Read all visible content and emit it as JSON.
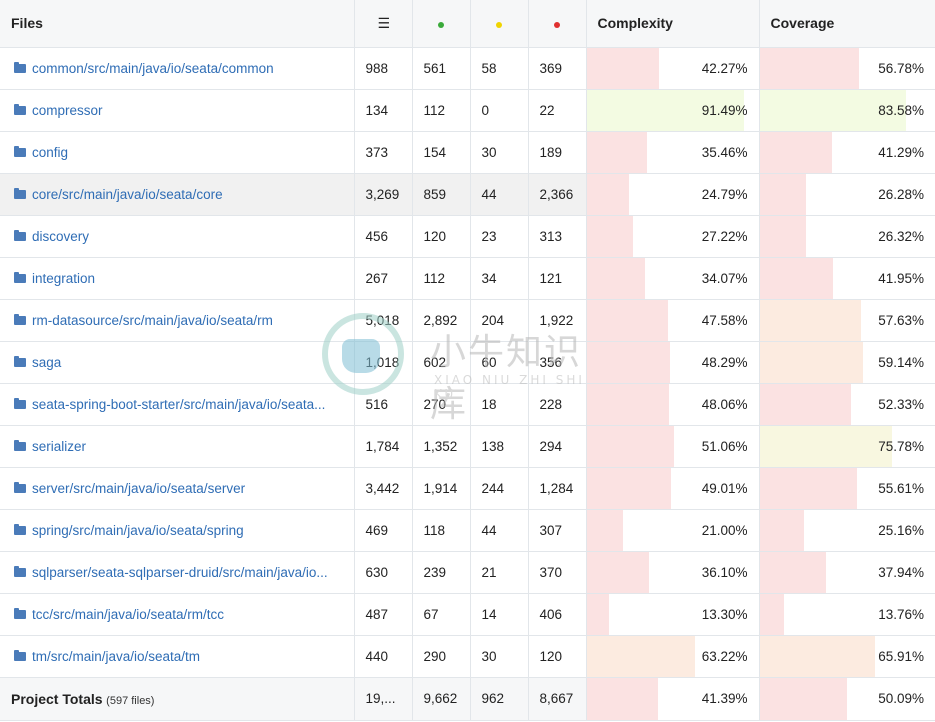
{
  "header": {
    "files": "Files",
    "lines_icon": "lines-icon",
    "complexity": "Complexity",
    "coverage": "Coverage",
    "colors": {
      "covered": "#3aaa3a",
      "partial": "#f0d400",
      "missed": "#e03030"
    }
  },
  "rows": [
    {
      "name": "common/src/main/java/io/seata/common",
      "lines": "988",
      "covered": "561",
      "partial": "58",
      "missed": "369",
      "complexity": "42.27%",
      "coverage": "56.78%",
      "complexity_fraction": 0.4227,
      "coverage_fraction": 0.5678,
      "complexity_color": "#fbe2e2",
      "coverage_color": "#fbe2e2"
    },
    {
      "name": "compressor",
      "lines": "134",
      "covered": "112",
      "partial": "0",
      "missed": "22",
      "complexity": "91.49%",
      "coverage": "83.58%",
      "complexity_fraction": 0.9149,
      "coverage_fraction": 0.8358,
      "complexity_color": "#f3fbe2",
      "coverage_color": "#f3fbe2"
    },
    {
      "name": "config",
      "lines": "373",
      "covered": "154",
      "partial": "30",
      "missed": "189",
      "complexity": "35.46%",
      "coverage": "41.29%",
      "complexity_fraction": 0.3546,
      "coverage_fraction": 0.4129,
      "complexity_color": "#fbe2e2",
      "coverage_color": "#fbe2e2"
    },
    {
      "name": "core/src/main/java/io/seata/core",
      "lines": "3,269",
      "covered": "859",
      "partial": "44",
      "missed": "2,366",
      "complexity": "24.79%",
      "coverage": "26.28%",
      "complexity_fraction": 0.2479,
      "coverage_fraction": 0.2628,
      "complexity_color": "#fbe2e2",
      "coverage_color": "#fbe2e2",
      "highlight": true
    },
    {
      "name": "discovery",
      "lines": "456",
      "covered": "120",
      "partial": "23",
      "missed": "313",
      "complexity": "27.22%",
      "coverage": "26.32%",
      "complexity_fraction": 0.2722,
      "coverage_fraction": 0.2632,
      "complexity_color": "#fbe2e2",
      "coverage_color": "#fbe2e2"
    },
    {
      "name": "integration",
      "lines": "267",
      "covered": "112",
      "partial": "34",
      "missed": "121",
      "complexity": "34.07%",
      "coverage": "41.95%",
      "complexity_fraction": 0.3407,
      "coverage_fraction": 0.4195,
      "complexity_color": "#fbe2e2",
      "coverage_color": "#fbe2e2"
    },
    {
      "name": "rm-datasource/src/main/java/io/seata/rm",
      "lines": "5,018",
      "covered": "2,892",
      "partial": "204",
      "missed": "1,922",
      "complexity": "47.58%",
      "coverage": "57.63%",
      "complexity_fraction": 0.4758,
      "coverage_fraction": 0.5763,
      "complexity_color": "#fbe2e2",
      "coverage_color": "#fcebe0"
    },
    {
      "name": "saga",
      "lines": "1,018",
      "covered": "602",
      "partial": "60",
      "missed": "356",
      "complexity": "48.29%",
      "coverage": "59.14%",
      "complexity_fraction": 0.4829,
      "coverage_fraction": 0.5914,
      "complexity_color": "#fbe2e2",
      "coverage_color": "#fcebe0"
    },
    {
      "name": "seata-spring-boot-starter/src/main/java/io/seata...",
      "lines": "516",
      "covered": "270",
      "partial": "18",
      "missed": "228",
      "complexity": "48.06%",
      "coverage": "52.33%",
      "complexity_fraction": 0.4806,
      "coverage_fraction": 0.5233,
      "complexity_color": "#fbe2e2",
      "coverage_color": "#fbe2e2"
    },
    {
      "name": "serializer",
      "lines": "1,784",
      "covered": "1,352",
      "partial": "138",
      "missed": "294",
      "complexity": "51.06%",
      "coverage": "75.78%",
      "complexity_fraction": 0.5106,
      "coverage_fraction": 0.7578,
      "complexity_color": "#fbe2e2",
      "coverage_color": "#f8f7e0"
    },
    {
      "name": "server/src/main/java/io/seata/server",
      "lines": "3,442",
      "covered": "1,914",
      "partial": "244",
      "missed": "1,284",
      "complexity": "49.01%",
      "coverage": "55.61%",
      "complexity_fraction": 0.4901,
      "coverage_fraction": 0.5561,
      "complexity_color": "#fbe2e2",
      "coverage_color": "#fbe2e2"
    },
    {
      "name": "spring/src/main/java/io/seata/spring",
      "lines": "469",
      "covered": "118",
      "partial": "44",
      "missed": "307",
      "complexity": "21.00%",
      "coverage": "25.16%",
      "complexity_fraction": 0.21,
      "coverage_fraction": 0.2516,
      "complexity_color": "#fbe2e2",
      "coverage_color": "#fbe2e2"
    },
    {
      "name": "sqlparser/seata-sqlparser-druid/src/main/java/io...",
      "lines": "630",
      "covered": "239",
      "partial": "21",
      "missed": "370",
      "complexity": "36.10%",
      "coverage": "37.94%",
      "complexity_fraction": 0.361,
      "coverage_fraction": 0.3794,
      "complexity_color": "#fbe2e2",
      "coverage_color": "#fbe2e2"
    },
    {
      "name": "tcc/src/main/java/io/seata/rm/tcc",
      "lines": "487",
      "covered": "67",
      "partial": "14",
      "missed": "406",
      "complexity": "13.30%",
      "coverage": "13.76%",
      "complexity_fraction": 0.133,
      "coverage_fraction": 0.1376,
      "complexity_color": "#fbe2e2",
      "coverage_color": "#fbe2e2"
    },
    {
      "name": "tm/src/main/java/io/seata/tm",
      "lines": "440",
      "covered": "290",
      "partial": "30",
      "missed": "120",
      "complexity": "63.22%",
      "coverage": "65.91%",
      "complexity_fraction": 0.6322,
      "coverage_fraction": 0.6591,
      "complexity_color": "#fcebe0",
      "coverage_color": "#fcebe0"
    }
  ],
  "totals": {
    "label": "Project Totals",
    "count": "(597 files)",
    "lines": "19,...",
    "covered": "9,662",
    "partial": "962",
    "missed": "8,667",
    "complexity": "41.39%",
    "coverage": "50.09%",
    "complexity_fraction": 0.4139,
    "coverage_fraction": 0.5009,
    "complexity_color": "#fbe2e2",
    "coverage_color": "#fbe2e2"
  },
  "watermark": {
    "title": "小牛知识库",
    "subtitle": "XIAO NIU ZHI SHI KU"
  }
}
